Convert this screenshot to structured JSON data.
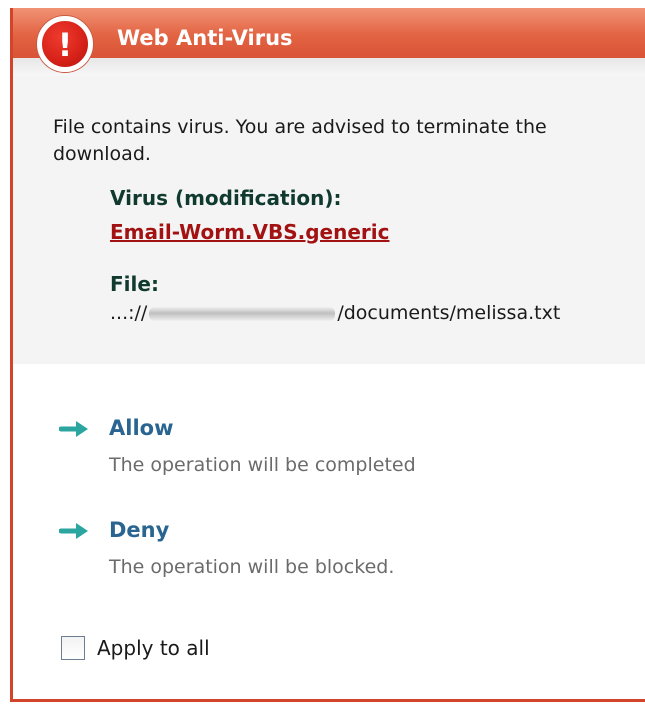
{
  "window": {
    "title": "Web Anti-Virus",
    "alert_symbol": "!",
    "icon": "alert-exclamation-icon"
  },
  "info": {
    "message": "File contains virus. You are advised to terminate the download.",
    "virus_label": "Virus (modification):",
    "virus_name": "Email-Worm.VBS.generic",
    "file_label": "File:",
    "file_path_prefix": "...://",
    "file_path_suffix": "/documents/melissa.txt"
  },
  "actions": [
    {
      "label": "Allow",
      "description": "The operation will be completed",
      "icon": "arrow-right-icon"
    },
    {
      "label": "Deny",
      "description": "The operation will be blocked.",
      "icon": "arrow-right-icon"
    }
  ],
  "apply_to_all": {
    "label": "Apply to all",
    "checked": false
  },
  "colors": {
    "title_bar": "#d2452b",
    "alert_red": "#d8231a",
    "virus_name": "#a31212",
    "action_label": "#2a6592",
    "arrow": "#2aa5a0"
  }
}
